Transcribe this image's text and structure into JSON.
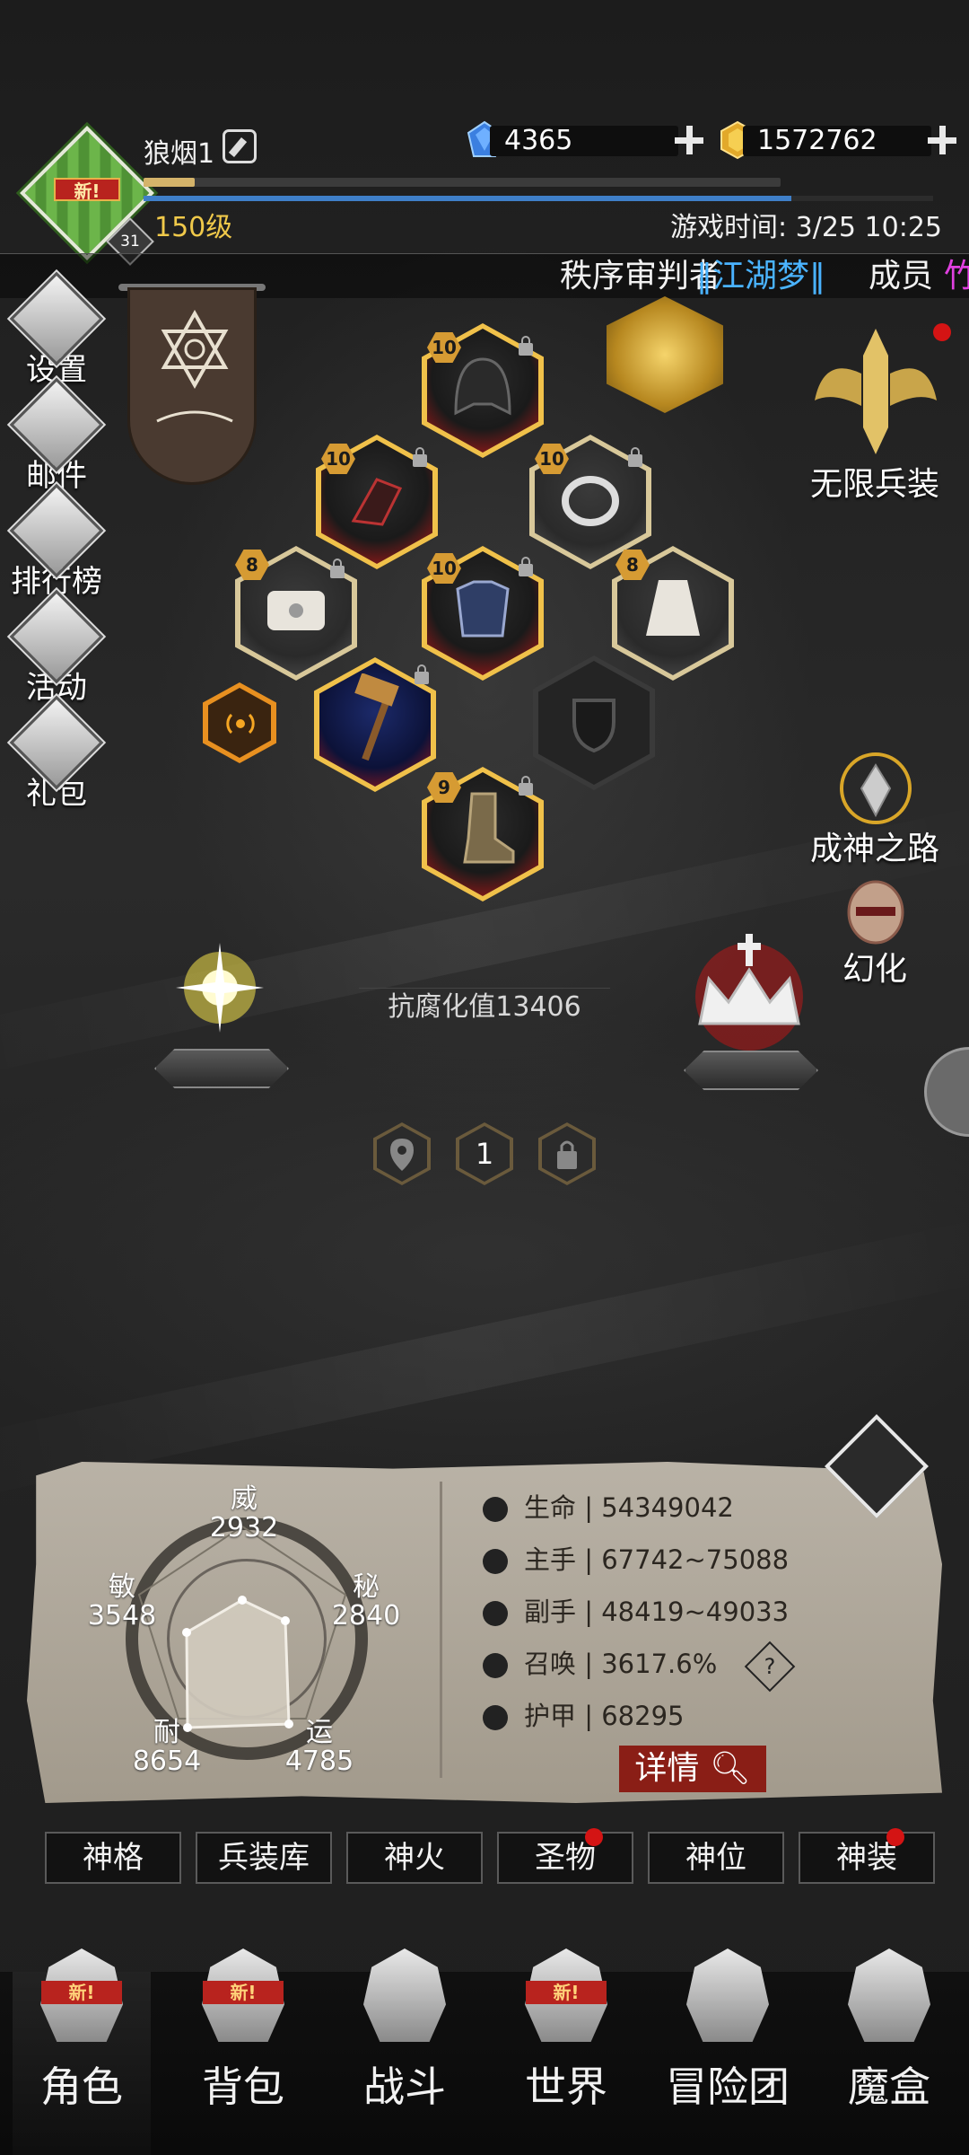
{
  "player": {
    "name": "狼烟1",
    "level": "150级",
    "rank_badge": "31",
    "new_tag": "新!",
    "xp_fraction": 0.08,
    "exp2_fraction": 0.82
  },
  "currency": {
    "gems": "4365",
    "gold": "1572762"
  },
  "game_time": "游戏时间: 3/25 10:25",
  "ticker": {
    "title": "秩序审判者",
    "guild": "‖江湖梦‖",
    "role": "成员",
    "extra": "竹"
  },
  "left_menu": [
    "设置",
    "邮件",
    "排行榜",
    "活动",
    "礼包"
  ],
  "right_menu": {
    "infinite_gear": "无限兵装",
    "god_path": "成神之路",
    "illusion": "幻化"
  },
  "equipment": {
    "helmet_level": "10",
    "gloves_level": "10",
    "ring_level": "10",
    "belt_level": "8",
    "armor_level": "10",
    "cape_level": "8",
    "boots_level": "9"
  },
  "resist": "抗腐化值13406",
  "pager": {
    "current": "1"
  },
  "radar": {
    "wei_label": "威",
    "wei": "2932",
    "mi_label": "秘",
    "mi": "2840",
    "yun_label": "运",
    "yun": "4785",
    "nai_label": "耐",
    "nai": "8654",
    "min_label": "敏",
    "min": "3548"
  },
  "stats": [
    {
      "label": "生命",
      "value": "54349042"
    },
    {
      "label": "主手",
      "value": "67742~75088"
    },
    {
      "label": "副手",
      "value": "48419~49033"
    },
    {
      "label": "召唤",
      "value": "3617.6%"
    },
    {
      "label": "护甲",
      "value": "68295"
    }
  ],
  "stat_help": "?",
  "detail_button": "详情",
  "tabs": [
    "神格",
    "兵装库",
    "神火",
    "圣物",
    "神位",
    "神装"
  ],
  "nav": [
    "角色",
    "背包",
    "战斗",
    "世界",
    "冒险团",
    "魔盒"
  ],
  "nav_new": "新!",
  "colors": {
    "accent_gold": "#f0c94a",
    "guild_blue": "#4ab3ff",
    "badge_red": "#d41414"
  }
}
